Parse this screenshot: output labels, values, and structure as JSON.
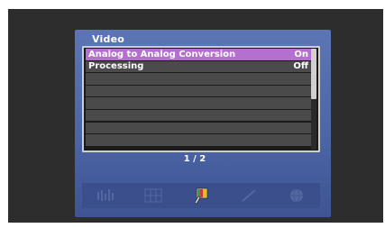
{
  "menu": {
    "title": "Video",
    "items": [
      {
        "label": "Analog to Analog Conversion",
        "value": "On",
        "selected": true
      },
      {
        "label": "Processing",
        "value": "Off",
        "selected": false
      }
    ],
    "page_indicator": "1 / 2",
    "scroll_fraction": 0.5
  },
  "icon_bar": {
    "icons": [
      "audio-icon",
      "grid-icon",
      "video-icon",
      "pen-icon",
      "globe-icon"
    ],
    "active_icon": "video-icon"
  },
  "colors": {
    "panel": "#4d66a6",
    "selected_row": "#b56fd0",
    "row": "#4b4b4b",
    "background": "#2d2d2d"
  }
}
